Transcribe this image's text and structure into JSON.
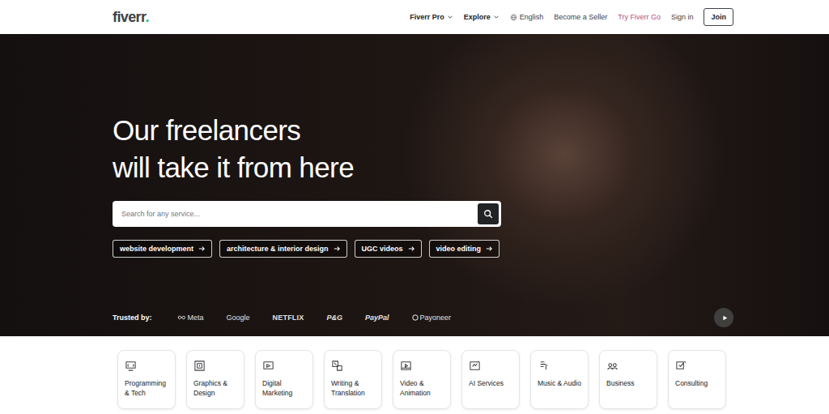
{
  "header": {
    "logo": {
      "text": "fiverr",
      "dot": "."
    },
    "nav": [
      {
        "label": "Fiverr Pro",
        "kind": "dropdown"
      },
      {
        "label": "Explore",
        "kind": "dropdown"
      },
      {
        "label": "English",
        "kind": "language"
      },
      {
        "label": "Become a Seller",
        "kind": "link"
      },
      {
        "label": "Try Fiverr Go",
        "kind": "accent"
      },
      {
        "label": "Sign in",
        "kind": "link"
      },
      {
        "label": "Join",
        "kind": "button"
      }
    ]
  },
  "hero": {
    "heading": [
      "Our freelancers",
      "will take it from here"
    ],
    "search": {
      "placeholder": "Search for any service..."
    },
    "tags": [
      "website development",
      "architecture & interior design",
      "UGC videos",
      "video editing"
    ],
    "trusted": {
      "label": "Trusted by:",
      "brands": [
        {
          "name": "Meta",
          "kind": "meta"
        },
        {
          "name": "Google",
          "kind": "plain"
        },
        {
          "name": "NETFLIX",
          "kind": "bold"
        },
        {
          "name": "P&G",
          "kind": "italic"
        },
        {
          "name": "PayPal",
          "kind": "italic"
        },
        {
          "name": "Payoneer",
          "kind": "circle"
        }
      ]
    }
  },
  "categories": [
    {
      "label": "Programming & Tech"
    },
    {
      "label": "Graphics & Design"
    },
    {
      "label": "Digital Marketing"
    },
    {
      "label": "Writing & Translation"
    },
    {
      "label": "Video & Animation"
    },
    {
      "label": "AI Services"
    },
    {
      "label": "Music & Audio"
    },
    {
      "label": "Business"
    },
    {
      "label": "Consulting"
    }
  ]
}
